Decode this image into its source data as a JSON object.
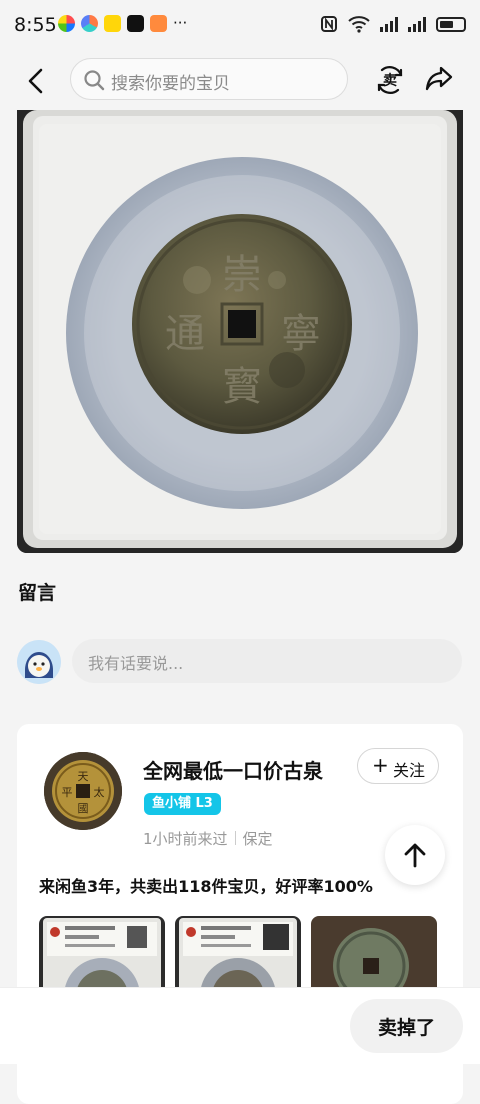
{
  "status_bar": {
    "time": "8:55",
    "notification_icons": [
      "app-icon-1",
      "app-icon-2",
      "app-icon-3",
      "app-icon-4",
      "app-icon-5"
    ],
    "more": "···",
    "battery_level": 0.6
  },
  "header": {
    "back_icon": "back-icon",
    "search_placeholder": "搜索你要的宝贝",
    "sell_icon": "sell-icon",
    "share_icon": "share-icon"
  },
  "comments": {
    "title": "留言",
    "input_placeholder": "我有话要说..."
  },
  "seller": {
    "name": "全网最低一口价古泉",
    "follow_label": "关注",
    "shop_badge": "鱼小铺 L3",
    "last_seen": "1小时前来过",
    "location": "保定",
    "stats": "来闲鱼3年，共卖出118件宝贝，好评率100%"
  },
  "colors": {
    "badge": "#14c5e8",
    "background": "#f4f4f4"
  },
  "bottom_bar": {
    "sell_button": "卖掉了"
  }
}
